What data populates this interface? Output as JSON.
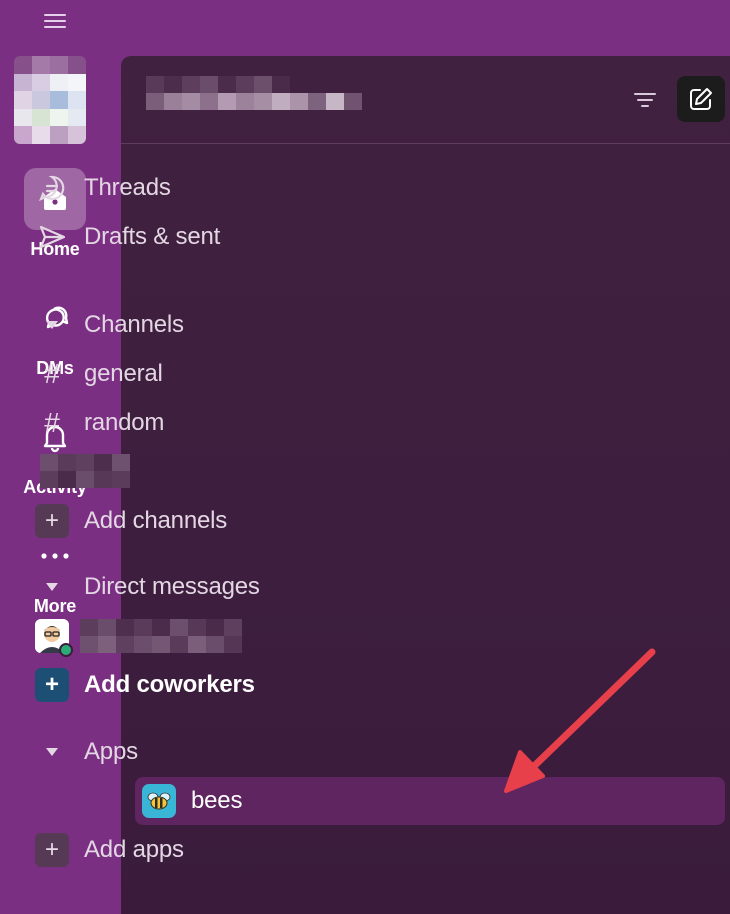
{
  "rail": {
    "items": [
      {
        "label": "Home"
      },
      {
        "label": "DMs"
      },
      {
        "label": "Activity"
      },
      {
        "label": "More"
      }
    ]
  },
  "sidebar": {
    "nav": [
      {
        "label": "Threads",
        "icon": "threads-icon"
      },
      {
        "label": "Drafts & sent",
        "icon": "send-icon"
      }
    ],
    "channels_header": "Channels",
    "channels": [
      {
        "prefix": "#",
        "name": "general"
      },
      {
        "prefix": "#",
        "name": "random"
      }
    ],
    "add_channels": "Add channels",
    "dm_header": "Direct messages",
    "add_coworkers": "Add coworkers",
    "apps_header": "Apps",
    "apps": [
      {
        "name": "bees"
      }
    ],
    "add_apps": "Add apps",
    "plus_glyph": "+"
  },
  "colors": {
    "rail_bg": "#7b2f82",
    "panel_bg": "#40213f",
    "selected_row": "#5e2560",
    "arrow": "#e8404a",
    "presence": "#2bac76",
    "add_coworkers_tile": "#1d4f75"
  }
}
